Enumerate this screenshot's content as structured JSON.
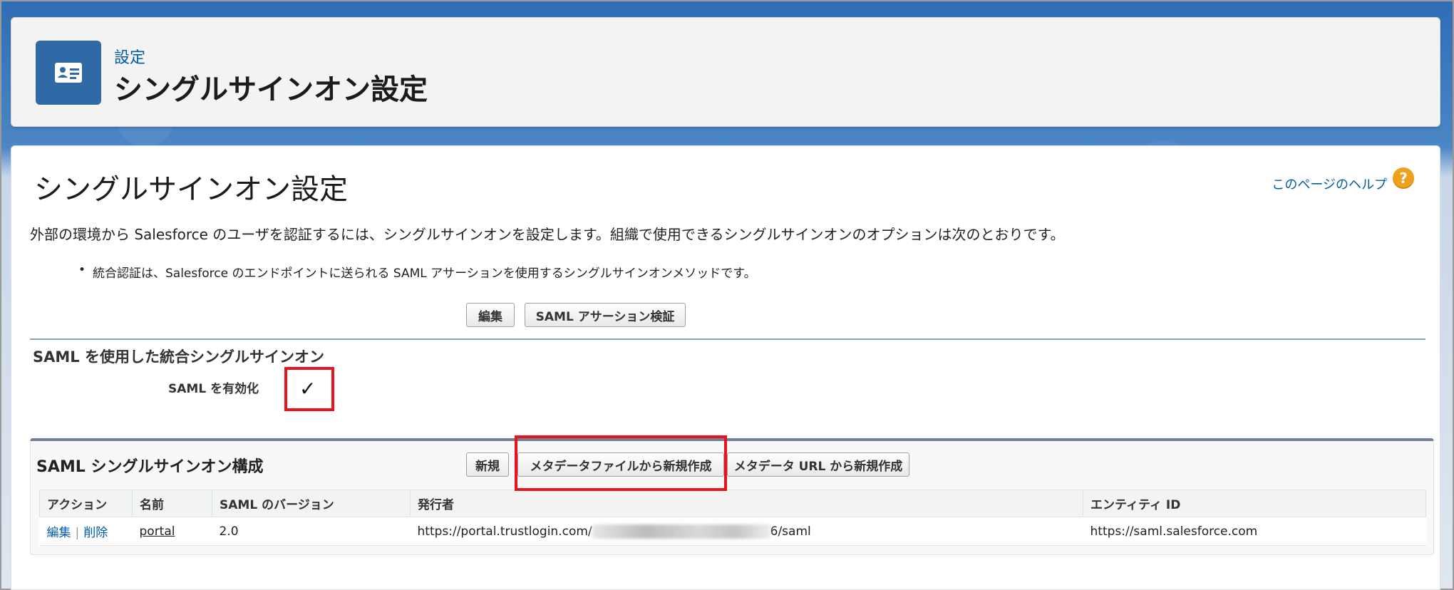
{
  "header": {
    "breadcrumb": "設定",
    "title": "シングルサインオン設定",
    "icon": "contact-card-icon",
    "icon_color": "#2f6aa6"
  },
  "main": {
    "title": "シングルサインオン設定",
    "help_link": "このページのヘルプ",
    "intro": "外部の環境から Salesforce のユーザを認証するには、シングルサインオンを設定します。組織で使用できるシングルサインオンのオプションは次のとおりです。",
    "bullet": "統合認証は、Salesforce のエンドポイントに送られる SAML アサーションを使用するシングルサインオンメソッドです。",
    "buttons": {
      "edit": "編集",
      "saml_validate": "SAML アサーション検証"
    },
    "saml_section": {
      "title": "SAML を使用した統合シングルサインオン",
      "enable_label": "SAML を有効化",
      "enabled_mark": "✓"
    }
  },
  "related": {
    "title": "SAML シングルサインオン構成",
    "buttons": {
      "new": "新規",
      "new_from_metadata_file": "メタデータファイルから新規作成",
      "new_from_metadata_url": "メタデータ URL から新規作成"
    },
    "columns": [
      "アクション",
      "名前",
      "SAML のバージョン",
      "発行者",
      "エンティティ ID"
    ],
    "rows": [
      {
        "action_edit": "編集",
        "action_sep": "|",
        "action_delete": "削除",
        "name": "portal",
        "version": "2.0",
        "issuer_prefix": "https://portal.trustlogin.com/",
        "issuer_suffix": "6/saml",
        "entity_id": "https://saml.salesforce.com"
      }
    ]
  },
  "colors": {
    "link": "#015ba7",
    "highlight": "#e8131e",
    "help_icon": "#f0a11b"
  }
}
